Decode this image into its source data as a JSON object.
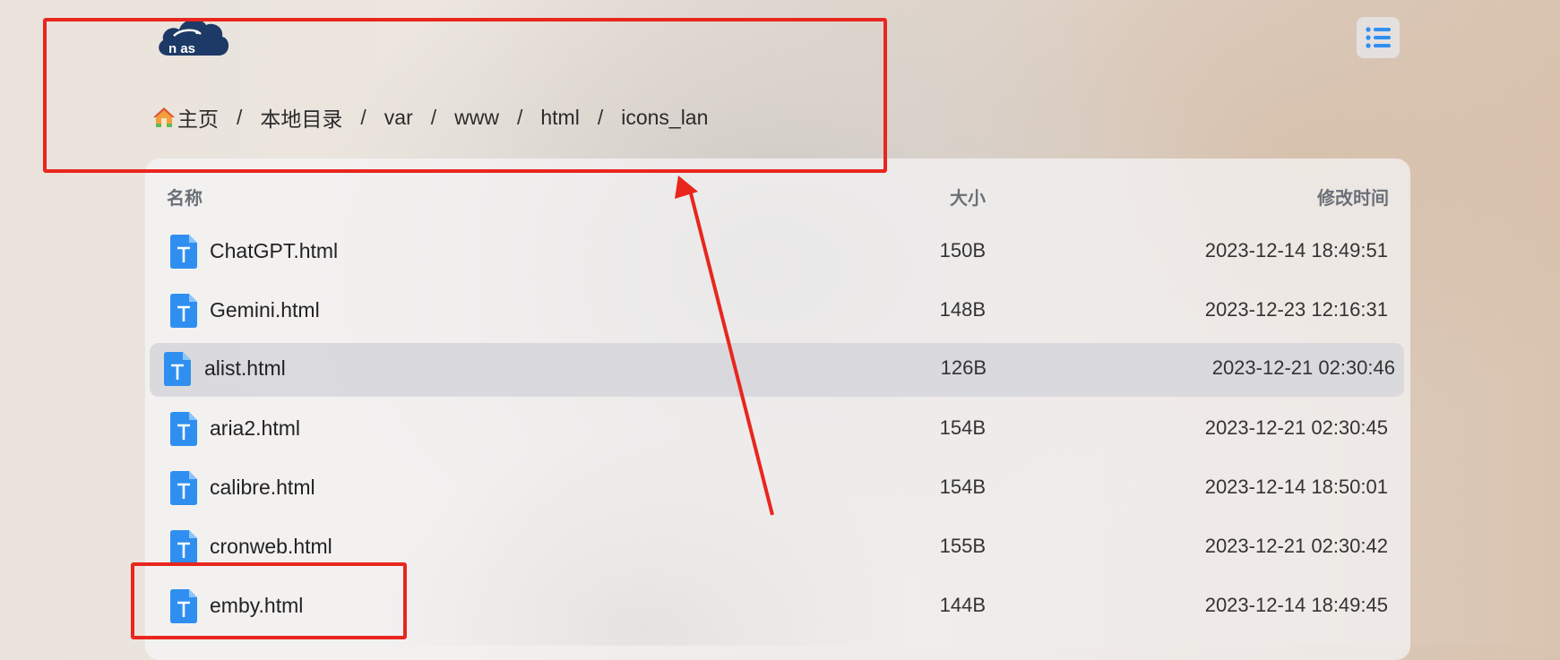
{
  "header": {
    "logo_text": "nas",
    "logo_alt": "fnos",
    "menu_icon": "list-icon"
  },
  "breadcrumb": {
    "home_icon": "house-icon",
    "items": [
      "主页",
      "本地目录",
      "var",
      "www",
      "html",
      "icons_lan"
    ],
    "separator": "/"
  },
  "table": {
    "columns": {
      "name": "名称",
      "size": "大小",
      "modified": "修改时间"
    },
    "file_icon": "text-file-icon",
    "rows": [
      {
        "name": "ChatGPT.html",
        "size": "150B",
        "modified": "2023-12-14 18:49:51"
      },
      {
        "name": "Gemini.html",
        "size": "148B",
        "modified": "2023-12-23 12:16:31"
      },
      {
        "name": "alist.html",
        "size": "126B",
        "modified": "2023-12-21 02:30:46"
      },
      {
        "name": "aria2.html",
        "size": "154B",
        "modified": "2023-12-21 02:30:45"
      },
      {
        "name": "calibre.html",
        "size": "154B",
        "modified": "2023-12-14 18:50:01"
      },
      {
        "name": "cronweb.html",
        "size": "155B",
        "modified": "2023-12-21 02:30:42"
      },
      {
        "name": "emby.html",
        "size": "144B",
        "modified": "2023-12-14 18:49:45"
      }
    ],
    "highlighted_row": "alist.html"
  },
  "colors": {
    "accent": "#2f8ff0",
    "annotation": "#e8261e",
    "logo_navy": "#1d3a66"
  }
}
